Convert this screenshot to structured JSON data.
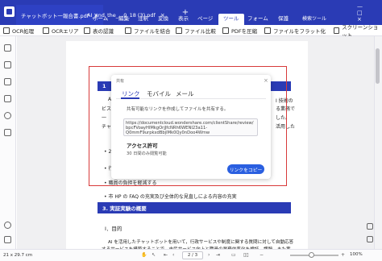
{
  "tabs": [
    {
      "label": "チャットボット一報合書.pdf",
      "close": "×"
    },
    {
      "label": "AI_and_the_...0_18 (3).pdf",
      "close": "×"
    }
  ],
  "tab_add": "+",
  "menus": [
    "ホーム",
    "編集",
    "注釈",
    "変換",
    "表示",
    "ページ",
    "ツール",
    "フォーム",
    "保護"
  ],
  "active_menu": "ツール",
  "search_label": "検索ツール",
  "window_controls": "— □ ×",
  "toolbar": [
    "OCR処理",
    "OCRエリア",
    "表の認識",
    "ファイルを結合",
    "ファイル比較",
    "PDFを圧縮",
    "ファイルをフラット化",
    "スクリーンショット"
  ],
  "doc": {
    "sec1_num": "1",
    "line_left_1": "A",
    "line_left_2": "ビス",
    "line_left_3": "一",
    "line_left_4": "チャ",
    "line_right_1": "I 技術の",
    "line_right_2": "る業務で",
    "line_right_3": "した。",
    "line_right_4": "活用した",
    "bullet_1": "• 24",
    "bullet_2": "• 行",
    "bullet_3": "• 職員の負担を軽減する",
    "bullet_4": "• 市 HP の FAQ の充実及び全体的な見直しによる内容の充実",
    "sec3_title": "3.   実証実験の概要",
    "sec3_sub": "I．目的",
    "para_1": "AI を活用したチャットボットを用いて，行政サービスや制度に関する質問に対して自動応答",
    "para_2": "するサービスを構築することで，市民サービス向上と職員の業務効率化を検証，課題，また実"
  },
  "dialog": {
    "title": "共有",
    "close": "×",
    "tabs": [
      "リンク",
      "モバイル",
      "メール"
    ],
    "description": "共有可能なリンクを作成してファイルを共有する。",
    "url_lines": [
      "https://documentcloud.wondershare.com/clientShare/review/",
      "bpcFVoayHlMkgOrjJfcNRh6WENI23a11-",
      "Q0mmF9urpkxdBbjlMk0Qy0nDoo4Wmw"
    ],
    "access_title": "アクセス許可",
    "access_note": "30 日間のみ閲覧可能",
    "copy_button": "リンクをコピー"
  },
  "status": {
    "page_size": "21 x 29.7 cm",
    "page_indicator": "2 / 3",
    "zoom": "100%"
  }
}
